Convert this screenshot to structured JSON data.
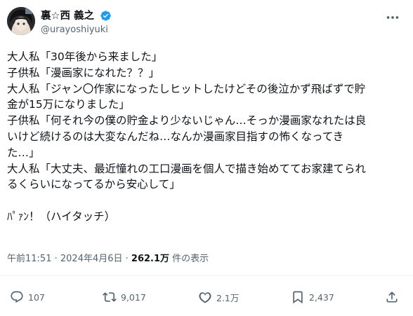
{
  "author": {
    "display_name": "裏☆西 義之",
    "handle": "@urayoshiyuki",
    "verified": true,
    "avatar_icon": "avatar-icon"
  },
  "tweet": {
    "lines": [
      "大人私「30年後から来ました」",
      "子供私「漫画家になれた？？」",
      "大人私「ジャン〇作家になったしヒットしたけどその後泣かず飛ばずで貯",
      "金が15万になりました」",
      "子供私「何それ今の僕の貯金より少ないじゃん…そっか漫画家なれたは良",
      "いけど続けるのは大変なんだね…なんか漫画家目指すの怖くなってき",
      "た…」",
      "大人私「大丈夫、最近憧れの工口漫画を個人で描き始めててお家建てられ",
      "るくらいになってるから安心して」",
      "",
      "ﾊﾟｧﾝ！（ハイタッチ）"
    ]
  },
  "meta": {
    "time": "午前11:51",
    "separator": " · ",
    "date": "2024年4月6日",
    "views_count": "262.1万",
    "views_label": " 件の表示"
  },
  "actions": {
    "replies": "107",
    "reposts": "9,017",
    "likes": "2.1万",
    "bookmarks": "2,437"
  },
  "colors": {
    "text": "#0f1419",
    "secondary": "#536471",
    "verified": "#1d9bf0",
    "divider": "#eff3f4"
  }
}
